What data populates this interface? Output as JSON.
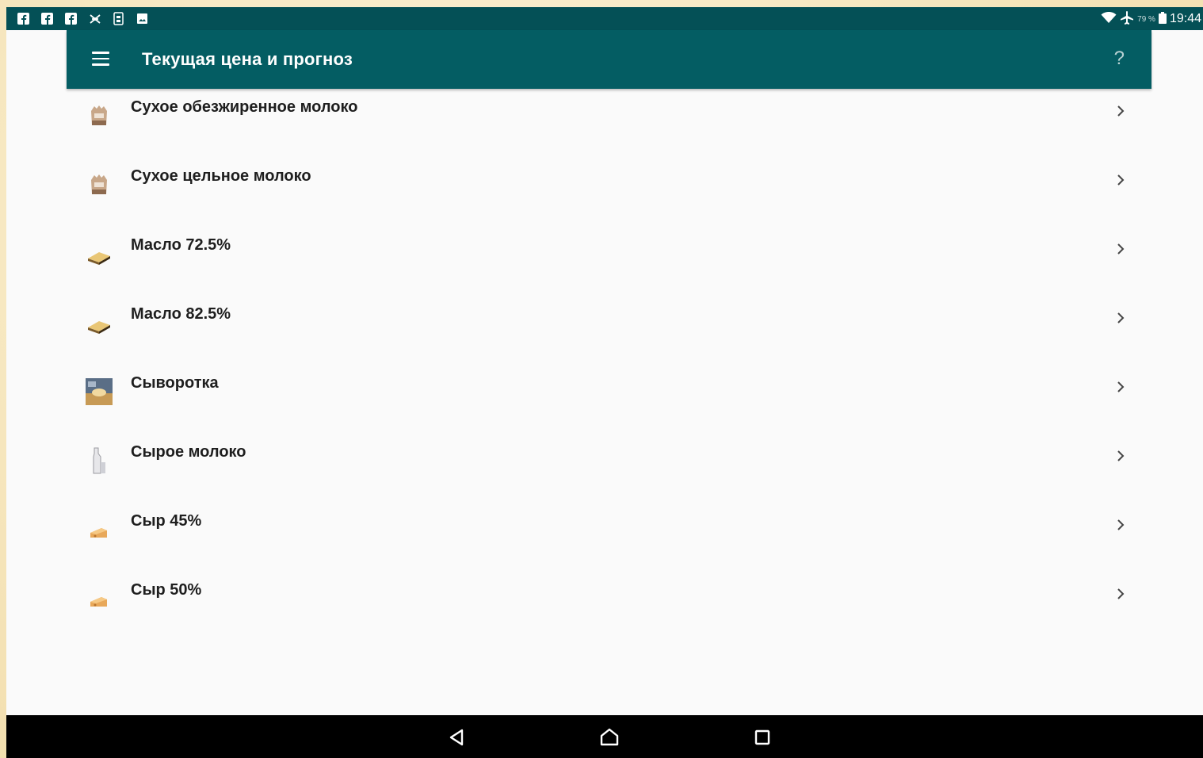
{
  "status_bar": {
    "notification_icons": [
      "facebook-icon",
      "facebook-icon",
      "facebook-icon",
      "basketball-icon",
      "sim-icon",
      "image-icon"
    ],
    "battery_percent": "79 %",
    "time": "19:44"
  },
  "app_bar": {
    "title": "Текущая цена и прогноз",
    "help_label": "?"
  },
  "items": [
    {
      "label": "Сухое обезжиренное молоко",
      "icon": "milk-powder-bag-icon"
    },
    {
      "label": "Сухое цельное молоко",
      "icon": "milk-powder-bag-icon"
    },
    {
      "label": "Масло 72.5%",
      "icon": "butter-icon"
    },
    {
      "label": "Масло 82.5%",
      "icon": "butter-icon"
    },
    {
      "label": "Сыворотка",
      "icon": "whey-icon"
    },
    {
      "label": "Сырое молоко",
      "icon": "milk-bottle-icon"
    },
    {
      "label": "Сыр 45%",
      "icon": "cheese-icon"
    },
    {
      "label": "Сыр 50%",
      "icon": "cheese-icon"
    }
  ],
  "colors": {
    "status_bar": "#045056",
    "app_bar": "#045d63",
    "background": "#fafafa",
    "nav_bar": "#000000"
  }
}
